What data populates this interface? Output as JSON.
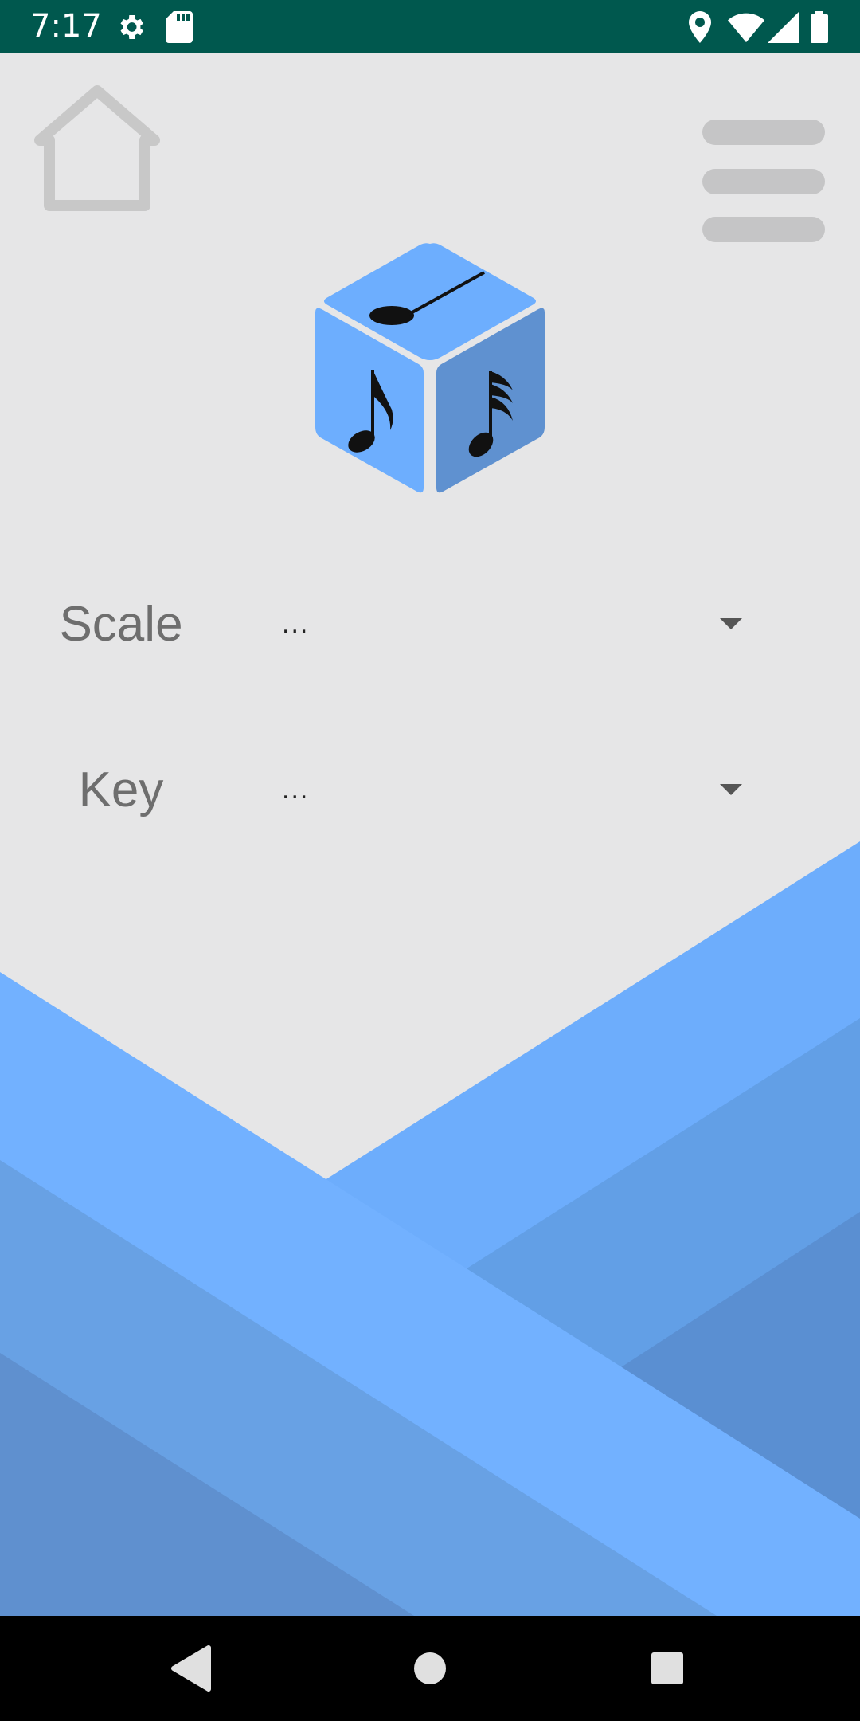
{
  "status_bar": {
    "time": "7:17",
    "left_icons": [
      "gear-icon",
      "sd-card-icon"
    ],
    "right_icons": [
      "location-icon",
      "wifi-icon",
      "signal-icon",
      "battery-icon"
    ],
    "background": "#00584e"
  },
  "toolbar": {
    "home_icon": "home-icon",
    "menu_icon": "hamburger-menu-icon"
  },
  "logo": {
    "icon": "music-dice-icon",
    "color_top": "#6daefe",
    "color_left": "#6daefe",
    "color_right": "#5f91d0"
  },
  "form": {
    "scale": {
      "label": "Scale",
      "value": "..."
    },
    "key": {
      "label": "Key",
      "value": "..."
    }
  },
  "nav_bar": {
    "back_icon": "back-icon",
    "home_icon": "home-circle-icon",
    "recents_icon": "recents-icon"
  }
}
